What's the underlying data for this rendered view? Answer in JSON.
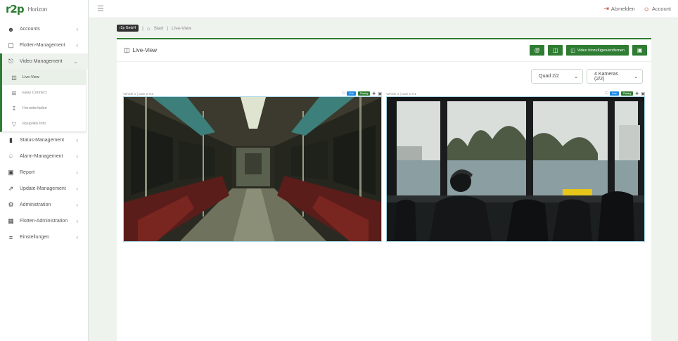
{
  "brand": {
    "logo_main": "r2",
    "logo_accent": "p",
    "name": "Horizon"
  },
  "topbar": {
    "logout_label": "Abmelden",
    "account_label": "Account"
  },
  "sidebar": {
    "items_top": [
      {
        "label": "Accounts",
        "icon": "users-icon"
      },
      {
        "label": "Flotten-Management",
        "icon": "fleet-icon"
      },
      {
        "label": "Video Management",
        "icon": "video-icon"
      }
    ],
    "sub_items": [
      {
        "label": "Live-View",
        "icon": "monitor-icon"
      },
      {
        "label": "Easy Connect",
        "icon": "grid-icon"
      },
      {
        "label": "Herunterladen",
        "icon": "download-icon"
      },
      {
        "label": "Rsup/Hls Info",
        "icon": "signal-icon"
      }
    ],
    "items_bottom": [
      {
        "label": "Status-Management",
        "icon": "chart-icon"
      },
      {
        "label": "Alarm-Management",
        "icon": "bell-icon"
      },
      {
        "label": "Report",
        "icon": "report-icon"
      },
      {
        "label": "Update-Management",
        "icon": "update-icon"
      },
      {
        "label": "Administration",
        "icon": "gear-icon"
      },
      {
        "label": "Flotten-Administration",
        "icon": "fleet-admin-icon"
      },
      {
        "label": "Einstellungen",
        "icon": "sliders-icon"
      }
    ]
  },
  "breadcrumb": {
    "company": "r2p GmbH",
    "home": "Start",
    "current": "Live-View"
  },
  "panel": {
    "title": "Live-View",
    "add_video_label": "Video hinzufügen/entfernen",
    "layout_select": "Quad 2/2",
    "camera_select": "4 Kameras (2/2)"
  },
  "cameras": [
    {
      "title": "Vehicle 1 | Cam 2 %2",
      "live": "Live",
      "status": "Playing"
    },
    {
      "title": "Vehicle 1 | Cam 1 %1",
      "live": "Live",
      "status": "Playing"
    }
  ],
  "colors": {
    "accent": "#2e7d32",
    "danger": "#c0392b",
    "live": "#1e88e5"
  }
}
